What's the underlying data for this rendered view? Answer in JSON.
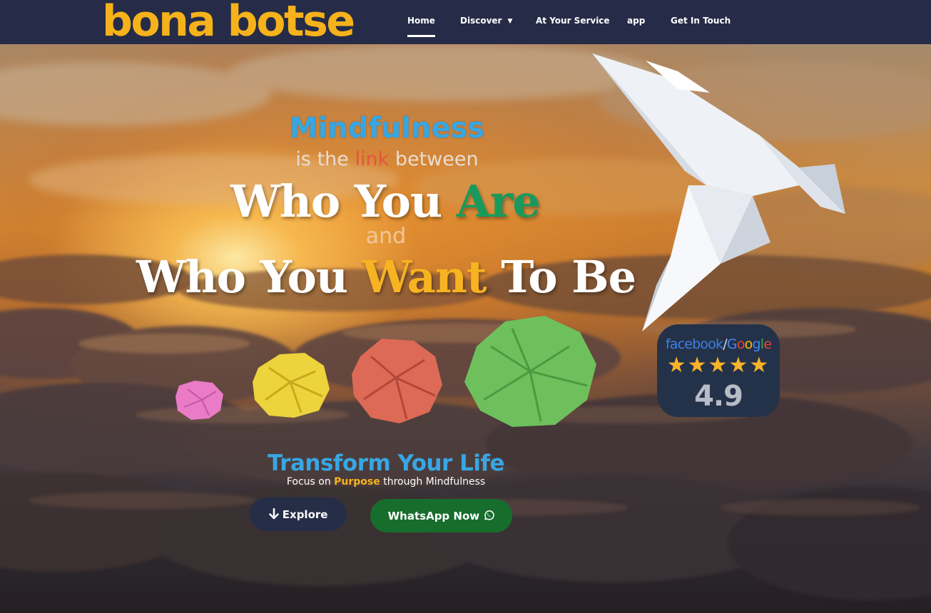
{
  "brand": {
    "logo": "bona botse"
  },
  "nav": {
    "items": [
      {
        "label": "Home",
        "active": true
      },
      {
        "label": "Discover",
        "has_dropdown": true
      },
      {
        "label": "At Your Service"
      },
      {
        "label": "app"
      },
      {
        "label": "Get In Touch"
      }
    ]
  },
  "hero": {
    "line1": "Mindfulness",
    "line2_pre": "is the ",
    "line2_accent": "link",
    "line2_post": " between",
    "line3_pre": "Who You ",
    "line3_accent": "Are",
    "line4": "and",
    "line5_pre": "Who You ",
    "line5_accent": "Want",
    "line5_post": " To Be"
  },
  "rating": {
    "brand_facebook": "facebook",
    "brand_slash": "/",
    "brand_google": [
      "G",
      "o",
      "o",
      "g",
      "l",
      "e"
    ],
    "stars": "★★★★★",
    "score": "4.9",
    "star_count": 5
  },
  "tagline": {
    "title": "Transform Your Life",
    "sub_pre": "Focus on ",
    "sub_accent": "Purpose",
    "sub_post": " through Mindfulness"
  },
  "buttons": {
    "explore": "Explore",
    "whatsapp": "WhatsApp Now"
  },
  "colors": {
    "nav_bg": "#262c47",
    "logo": "#f6b21b",
    "blue": "#38a6e3",
    "green": "#199a5c",
    "yellow": "#f7b321",
    "red": "#e5553e",
    "whatsapp_btn": "#176d2c",
    "explore_btn": "#252e46"
  },
  "icons": {
    "explore": "arrow-down-icon",
    "whatsapp": "whatsapp-icon",
    "discover": "chevron-down-icon"
  }
}
